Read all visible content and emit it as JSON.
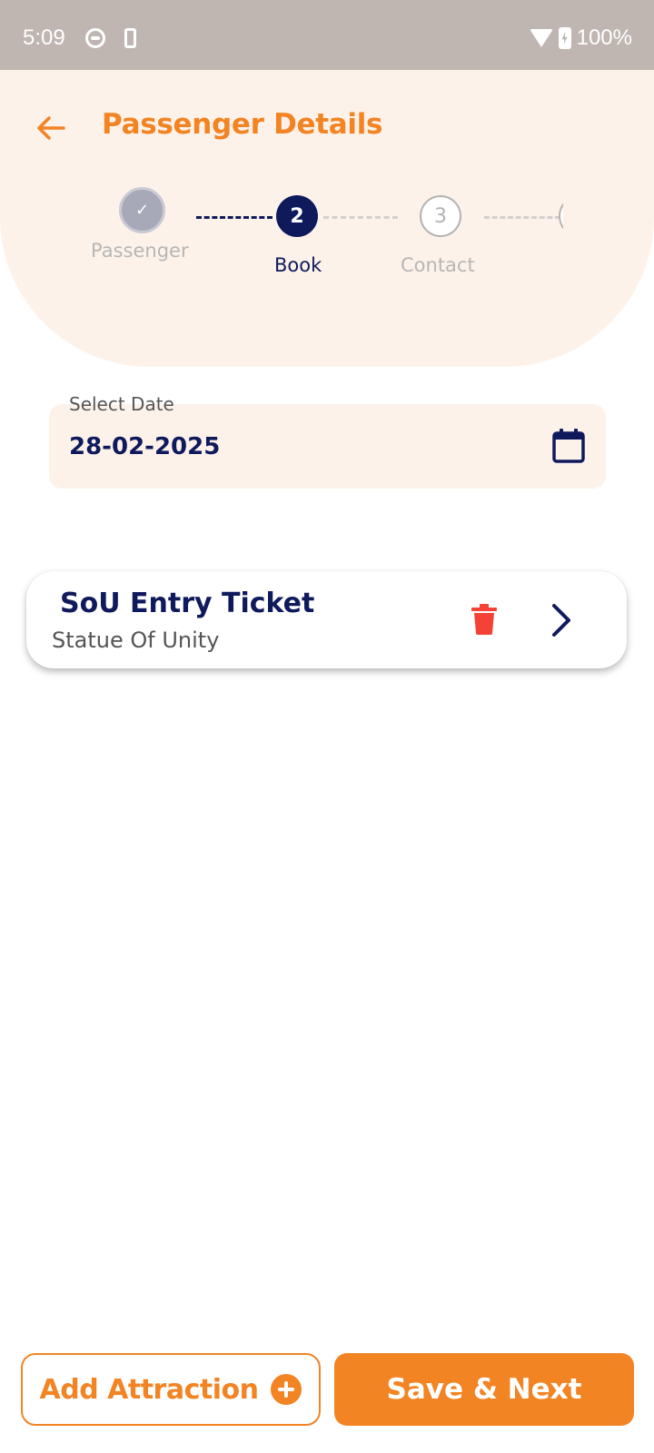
{
  "status_bar": {
    "time": "5:09",
    "battery": "100%"
  },
  "header": {
    "title": "Passenger Details",
    "accent_color": "#f28424",
    "primary_color": "#0f1a5c"
  },
  "stepper": {
    "steps": [
      {
        "number": "✓",
        "label": "Passenger",
        "state": "completed"
      },
      {
        "number": "2",
        "label": "Book",
        "state": "active"
      },
      {
        "number": "3",
        "label": "Contact",
        "state": "pending"
      },
      {
        "number": "",
        "label": "",
        "state": "pending"
      }
    ]
  },
  "date_field": {
    "label": "Select Date",
    "value": "28-02-2025"
  },
  "ticket": {
    "title": "SoU Entry Ticket",
    "subtitle": "Statue Of Unity"
  },
  "footer": {
    "add_label": "Add Attraction",
    "save_label": "Save & Next"
  },
  "icons": {
    "back": "arrow-left-icon",
    "calendar": "calendar-icon",
    "delete": "trash-icon",
    "next": "chevron-right-icon",
    "add": "plus-circle-icon"
  }
}
